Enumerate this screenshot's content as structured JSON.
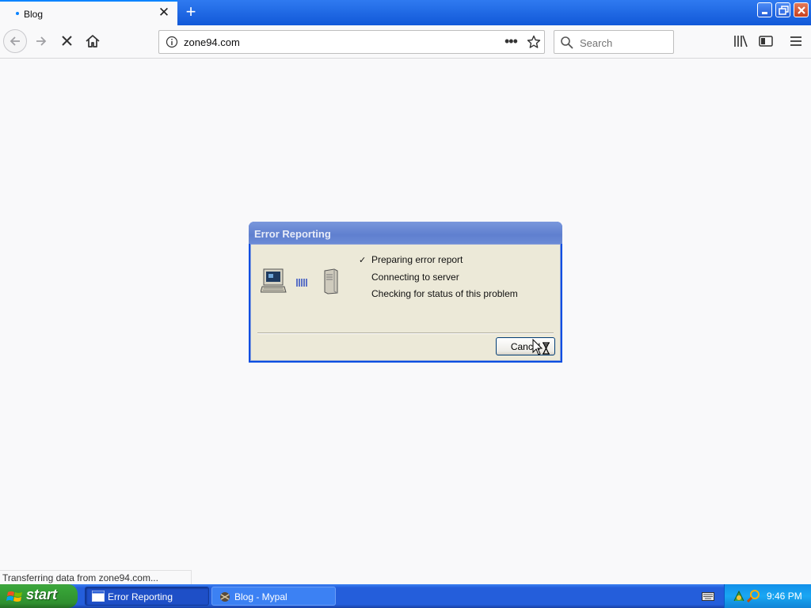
{
  "browser": {
    "tab": {
      "title": "Blog",
      "close_glyph": "✕"
    },
    "new_tab_glyph": "+",
    "url": "zone94.com",
    "page_actions_glyph": "•••",
    "search": {
      "placeholder": "Search"
    }
  },
  "dialog": {
    "title": "Error Reporting",
    "check_glyph": "✓",
    "steps": [
      {
        "label": "Preparing error report",
        "done": true
      },
      {
        "label": "Connecting to server",
        "done": false
      },
      {
        "label": "Checking for status of this problem",
        "done": false
      }
    ],
    "cancel_label": "Cancel"
  },
  "status_bar": {
    "text": "Transferring data from zone94.com..."
  },
  "taskbar": {
    "start_label": "start",
    "tasks": [
      {
        "label": "Error Reporting",
        "active": true
      },
      {
        "label": "Blog - Mypal",
        "active": false
      }
    ],
    "clock": "9:46 PM"
  },
  "colors": {
    "taskbar_blue": "#245edb",
    "start_green": "#37a337",
    "dialog_face": "#ece9d8",
    "accent": "#0a84ff"
  },
  "icons": [
    "close-icon",
    "new-tab-icon",
    "minimize-icon",
    "maximize-icon",
    "window-close-icon",
    "back-icon",
    "forward-icon",
    "stop-icon",
    "home-icon",
    "info-icon",
    "star-icon",
    "search-icon",
    "library-icon",
    "sidebar-icon",
    "hamburger-menu-icon",
    "computer-icon",
    "signal-waves-icon",
    "server-icon",
    "windows-flag-icon",
    "keyboard-icon"
  ]
}
